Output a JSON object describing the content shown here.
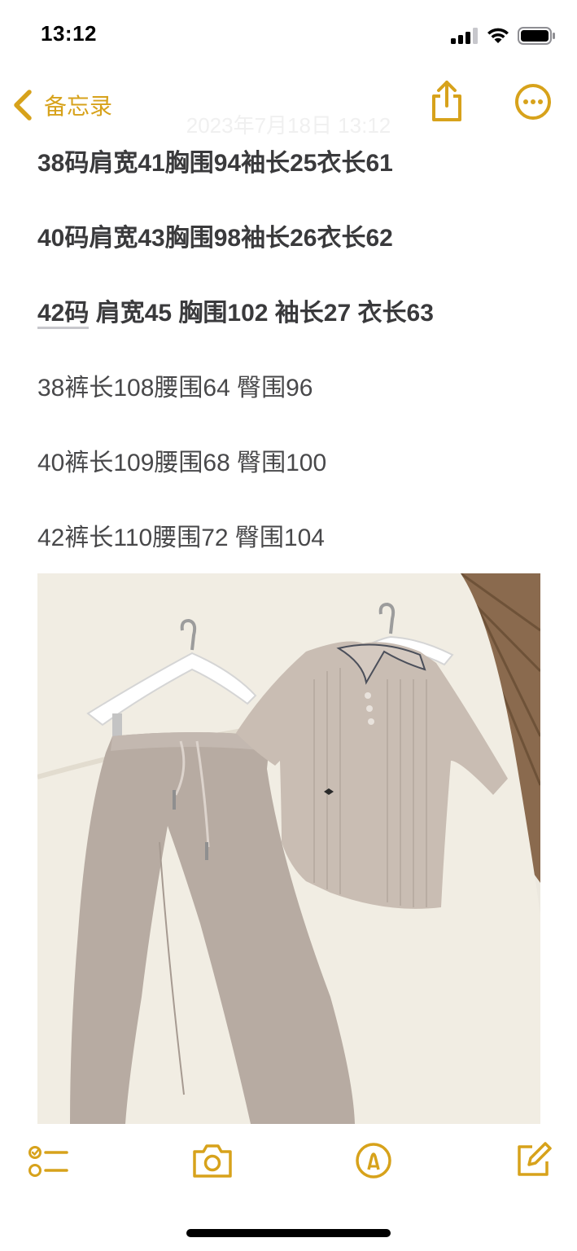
{
  "status_bar": {
    "time": "13:12",
    "icons": [
      "cellular-signal-icon",
      "wifi-icon",
      "battery-icon"
    ]
  },
  "nav": {
    "back_label": "备忘录",
    "ghost_date": "2023年7月18日 13:12",
    "icons": [
      "chevron-left-icon",
      "share-icon",
      "more-icon"
    ],
    "accent_color": "#d7a21b"
  },
  "note": {
    "lines": [
      "38码肩宽41胸围94袖长25衣长61",
      "40码肩宽43胸围98袖长26衣长62",
      "42码 肩宽45 胸围102 袖长27 衣长63",
      "38裤长108腰围64 臀围96",
      "40裤长109腰围68 臀围100",
      "42裤长110腰围72 臀围104"
    ],
    "line3_prefix": "42码",
    "line3_rest": " 肩宽45 胸围102 袖长27 衣长63"
  },
  "photo": {
    "description_icon": "clothing-photo"
  },
  "toolbar": {
    "icons": [
      "checklist-icon",
      "camera-icon",
      "markup-icon",
      "compose-icon"
    ]
  }
}
